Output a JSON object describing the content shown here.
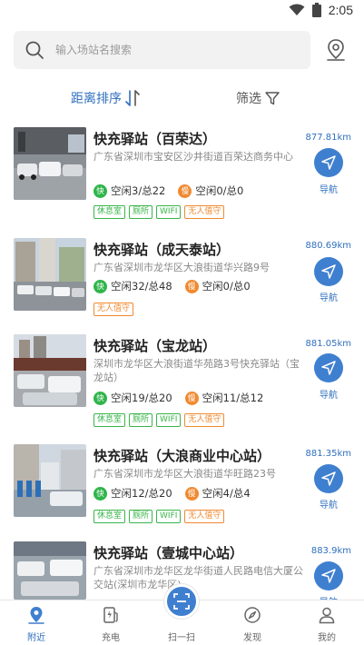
{
  "status_bar": {
    "time": "2:05",
    "wifi_icon": "wifi-icon",
    "battery_icon": "battery-icon"
  },
  "search": {
    "placeholder": "输入场站名搜索",
    "icon": "search-icon",
    "map_icon": "map-pin-icon"
  },
  "filters": {
    "sort_label": "距离排序",
    "filter_label": "筛选"
  },
  "colors": {
    "accent": "#3f7fcf",
    "text_accent": "#2f6fbe",
    "fast": "#2fb54a",
    "slow": "#f08a30"
  },
  "stations": [
    {
      "name": "快充驿站（百荣达）",
      "address": "广东省深圳市宝安区沙井街道百荣达商务中心",
      "fast_badge": "快",
      "fast_text": "空闲3/总22",
      "slow_badge": "慢",
      "slow_text": "空闲0/总0",
      "tags": [
        "休息室",
        "厕所",
        "WIFI",
        "无人值守"
      ],
      "distance": "877.81km",
      "nav_label": "导航"
    },
    {
      "name": "快充驿站（成天泰站）",
      "address": "广东省深圳市龙华区大浪街道华兴路9号",
      "fast_badge": "快",
      "fast_text": "空闲32/总48",
      "slow_badge": "慢",
      "slow_text": "空闲0/总0",
      "tags": [
        "无人值守"
      ],
      "distance": "880.69km",
      "nav_label": "导航"
    },
    {
      "name": "快充驿站（宝龙站）",
      "address": "深圳市龙华区大浪街道华苑路3号快充驿站（宝龙站）",
      "fast_badge": "快",
      "fast_text": "空闲19/总20",
      "slow_badge": "慢",
      "slow_text": "空闲11/总12",
      "tags": [
        "休息室",
        "厕所",
        "WIFI",
        "无人值守"
      ],
      "distance": "881.05km",
      "nav_label": "导航"
    },
    {
      "name": "快充驿站（大浪商业中心站）",
      "address": "广东省深圳市龙华区大浪街道华旺路23号",
      "fast_badge": "快",
      "fast_text": "空闲12/总20",
      "slow_badge": "慢",
      "slow_text": "空闲4/总4",
      "tags": [
        "休息室",
        "厕所",
        "WIFI",
        "无人值守"
      ],
      "distance": "881.35km",
      "nav_label": "导航"
    },
    {
      "name": "快充驿站（壹城中心站）",
      "address": "广东省深圳市龙华区龙华街道人民路电信大厦公交站(深圳市龙华区)",
      "distance": "883.9km",
      "nav_label": "导航"
    }
  ],
  "tabbar": {
    "items": [
      {
        "label": "附近",
        "icon": "location-icon",
        "active": true
      },
      {
        "label": "充电",
        "icon": "charger-icon",
        "active": false
      },
      {
        "label": "扫一扫",
        "icon": "scan-icon",
        "active": false
      },
      {
        "label": "发现",
        "icon": "compass-icon",
        "active": false
      },
      {
        "label": "我的",
        "icon": "user-icon",
        "active": false
      }
    ]
  }
}
